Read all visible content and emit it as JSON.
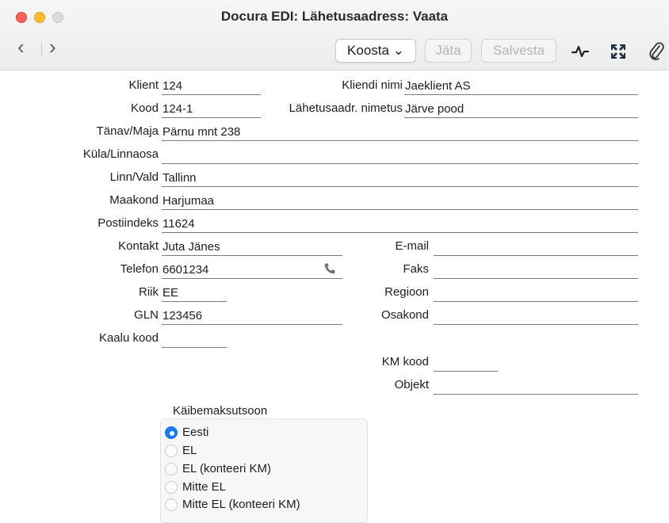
{
  "window": {
    "title": "Docura EDI: Lähetusaadress: Vaata"
  },
  "toolbar": {
    "back": "‹",
    "forward": "›",
    "koosta": "Koosta ⌄",
    "jata": "Jäta",
    "salvesta": "Salvesta"
  },
  "form": {
    "klient": {
      "label": "Klient",
      "value": "124"
    },
    "kliendi_nimi": {
      "label": "Kliendi nimi",
      "value": "Jaeklient AS"
    },
    "kood": {
      "label": "Kood",
      "value": "124-1"
    },
    "lahetusaadr_nimetus": {
      "label": "Lähetusaadr. nimetus",
      "value": "Järve pood"
    },
    "tanav": {
      "label": "Tänav/Maja",
      "value": "Pärnu mnt 238"
    },
    "kula": {
      "label": "Küla/Linnaosa",
      "value": ""
    },
    "linn": {
      "label": "Linn/Vald",
      "value": "Tallinn"
    },
    "maakond": {
      "label": "Maakond",
      "value": "Harjumaa"
    },
    "postiindeks": {
      "label": "Postiindeks",
      "value": "11624"
    },
    "kontakt": {
      "label": "Kontakt",
      "value": "Juta Jänes"
    },
    "email": {
      "label": "E-mail",
      "value": ""
    },
    "telefon": {
      "label": "Telefon",
      "value": "6601234"
    },
    "faks": {
      "label": "Faks",
      "value": ""
    },
    "riik": {
      "label": "Riik",
      "value": "EE"
    },
    "regioon": {
      "label": "Regioon",
      "value": ""
    },
    "gln": {
      "label": "GLN",
      "value": "123456"
    },
    "osakond": {
      "label": "Osakond",
      "value": ""
    },
    "kaalu_kood": {
      "label": "Kaalu kood",
      "value": ""
    },
    "km_kood": {
      "label": "KM kood",
      "value": ""
    },
    "objekt": {
      "label": "Objekt",
      "value": ""
    }
  },
  "kaibemaksutsoon": {
    "title": "Käibemaksutsoon",
    "options": [
      {
        "label": "Eesti",
        "selected": true
      },
      {
        "label": "EL",
        "selected": false
      },
      {
        "label": "EL (konteeri KM)",
        "selected": false
      },
      {
        "label": "Mitte EL",
        "selected": false
      },
      {
        "label": "Mitte EL (konteeri KM)",
        "selected": false
      }
    ]
  },
  "colors": {
    "accent": "#1a7cf5",
    "phone_icon": "#6f6f6f"
  }
}
